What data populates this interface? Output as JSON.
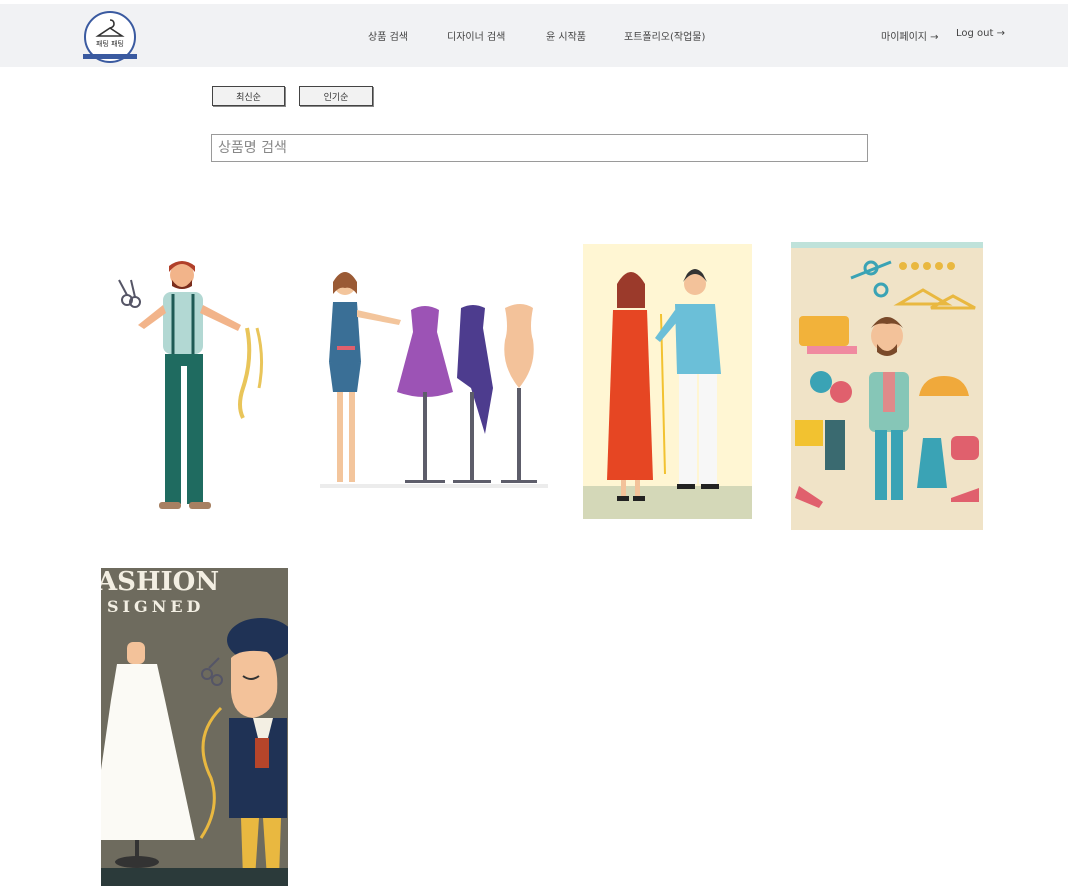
{
  "header": {
    "logo_text": "패팅 패팅",
    "nav": [
      {
        "label": "상품 검색"
      },
      {
        "label": "디자이너 검색"
      },
      {
        "label": "윤 시작품"
      },
      {
        "label": "포트폴리오(작업물)"
      }
    ],
    "mypage_label": "마이페이지 →",
    "logout_label": "Log out →"
  },
  "sort": {
    "latest_label": "최신순",
    "popular_label": "인기순"
  },
  "search": {
    "placeholder": "상품명 검색",
    "value": ""
  },
  "gallery": {
    "items": [
      {
        "icon": "tailor-with-scissors-illustration"
      },
      {
        "icon": "designer-with-dress-forms-illustration"
      },
      {
        "icon": "tailor-measuring-woman-illustration"
      },
      {
        "icon": "fashion-items-pattern-illustration"
      },
      {
        "icon": "fashion-designer-poster-illustration",
        "poster_title": "ASHION",
        "poster_subtitle": "SIGNED"
      }
    ]
  },
  "colors": {
    "topbar_bg": "#f1f2f4",
    "logo_blue": "#3a5aa0"
  }
}
